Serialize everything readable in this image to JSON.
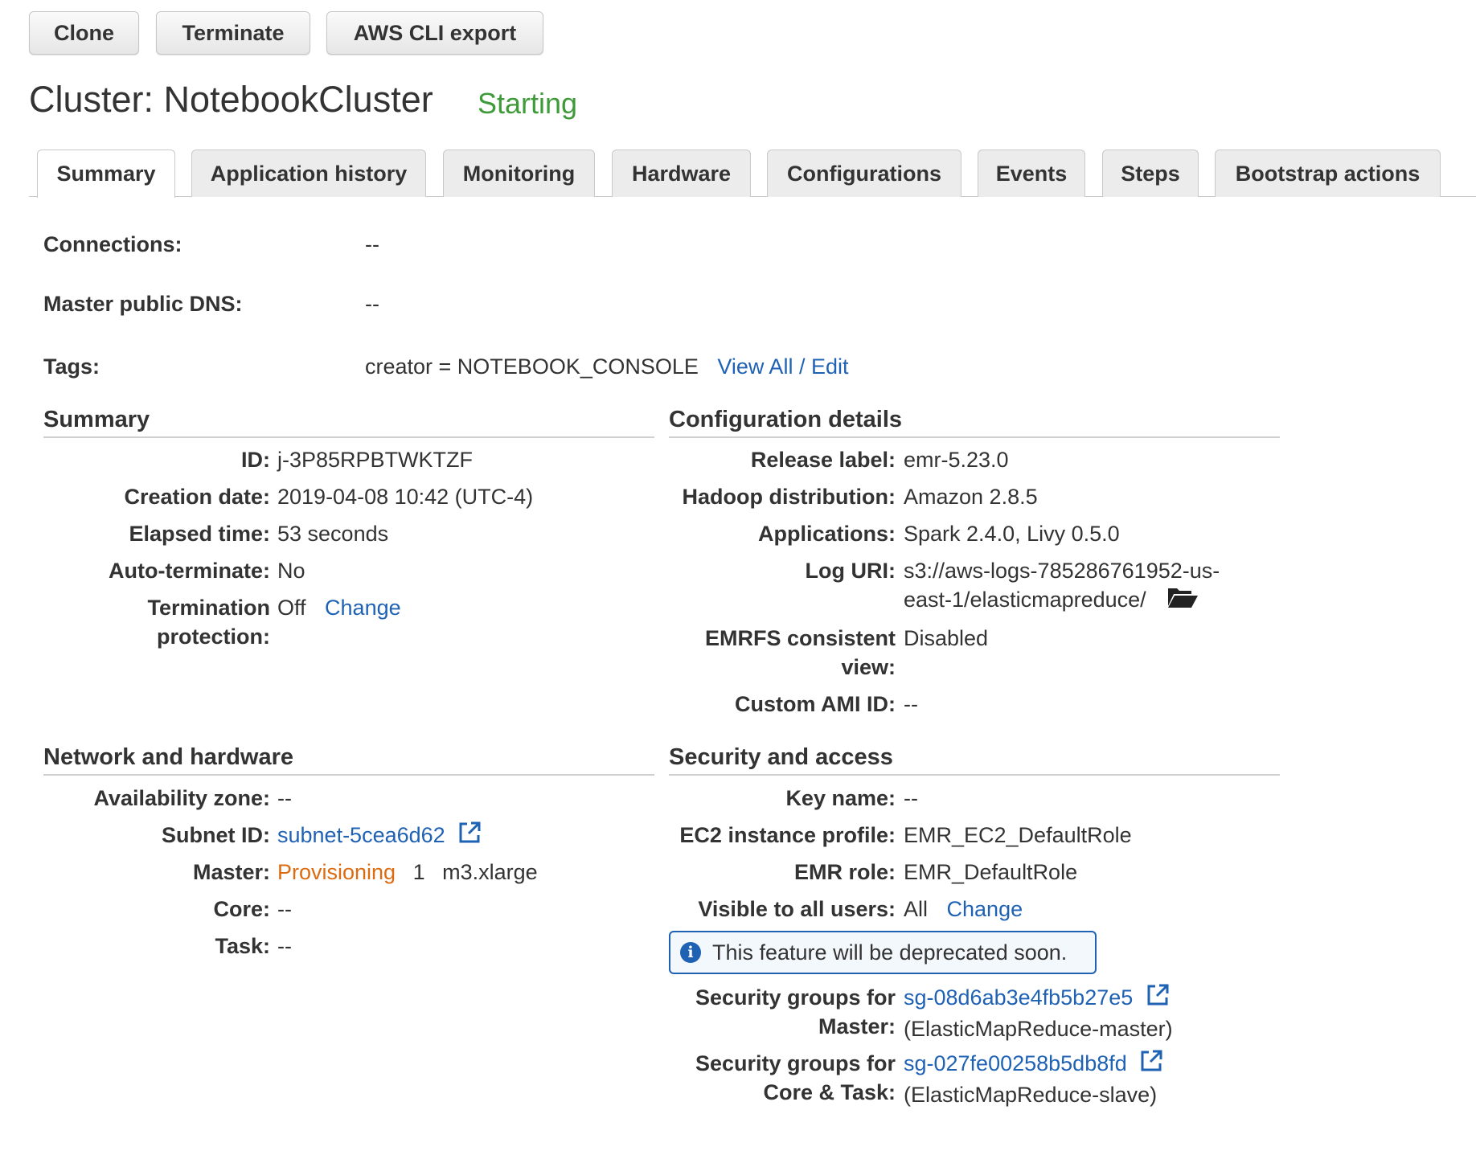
{
  "toolbar": {
    "clone": "Clone",
    "terminate": "Terminate",
    "cli_export": "AWS CLI export"
  },
  "cluster": {
    "title": "Cluster: NotebookCluster",
    "status": "Starting",
    "status_color": "#3f9b3a"
  },
  "tabs": [
    "Summary",
    "Application history",
    "Monitoring",
    "Hardware",
    "Configurations",
    "Events",
    "Steps",
    "Bootstrap actions"
  ],
  "overview": {
    "connections_label": "Connections:",
    "connections_value": "--",
    "dns_label": "Master public DNS:",
    "dns_value": "--",
    "tags_label": "Tags:",
    "tags_value": "creator = NOTEBOOK_CONSOLE",
    "tags_link": "View All / Edit"
  },
  "summary": {
    "heading": "Summary",
    "id_label": "ID:",
    "id_value": "j-3P85RPBTWKTZF",
    "created_label": "Creation date:",
    "created_value": "2019-04-08 10:42 (UTC-4)",
    "elapsed_label": "Elapsed time:",
    "elapsed_value": "53 seconds",
    "autoterm_label": "Auto-terminate:",
    "autoterm_value": "No",
    "termprot_label_1": "Termination",
    "termprot_label_2": "protection:",
    "termprot_value": "Off",
    "termprot_link": "Change"
  },
  "config": {
    "heading": "Configuration details",
    "release_label": "Release label:",
    "release_value": "emr-5.23.0",
    "hadoop_label": "Hadoop distribution:",
    "hadoop_value": "Amazon 2.8.5",
    "apps_label": "Applications:",
    "apps_value": "Spark 2.4.0, Livy 0.5.0",
    "log_label": "Log URI:",
    "log_value_1": "s3://aws-logs-785286761952-us-",
    "log_value_2": "east-1/elasticmapreduce/",
    "emrfs_label_1": "EMRFS consistent",
    "emrfs_label_2": "view:",
    "emrfs_value": "Disabled",
    "ami_label": "Custom AMI ID:",
    "ami_value": "--"
  },
  "network": {
    "heading": "Network and hardware",
    "az_label": "Availability zone:",
    "az_value": "--",
    "subnet_label": "Subnet ID:",
    "subnet_value": "subnet-5cea6d62",
    "master_label": "Master:",
    "master_status": "Provisioning",
    "master_count": "1",
    "master_type": "m3.xlarge",
    "core_label": "Core:",
    "core_value": "--",
    "task_label": "Task:",
    "task_value": "--"
  },
  "security": {
    "heading": "Security and access",
    "key_label": "Key name:",
    "key_value": "--",
    "profile_label": "EC2 instance profile:",
    "profile_value": "EMR_EC2_DefaultRole",
    "role_label": "EMR role:",
    "role_value": "EMR_DefaultRole",
    "visible_label": "Visible to all users:",
    "visible_value": "All",
    "visible_link": "Change",
    "deprecation_notice": "This feature will be deprecated soon.",
    "sg_master_label_1": "Security groups for",
    "sg_master_label_2": "Master:",
    "sg_master_id": "sg-08d6ab3e4fb5b27e5",
    "sg_master_name": "(ElasticMapReduce-master)",
    "sg_core_label_1": "Security groups for",
    "sg_core_label_2": "Core & Task:",
    "sg_core_id": "sg-027fe00258b5db8fd",
    "sg_core_name": "(ElasticMapReduce-slave)"
  },
  "icons": {
    "external_link": "external-link-icon",
    "folder": "folder-open-icon",
    "info": "info-icon"
  },
  "colors": {
    "link": "#1f62b4",
    "provisioning": "#dd6b10"
  }
}
